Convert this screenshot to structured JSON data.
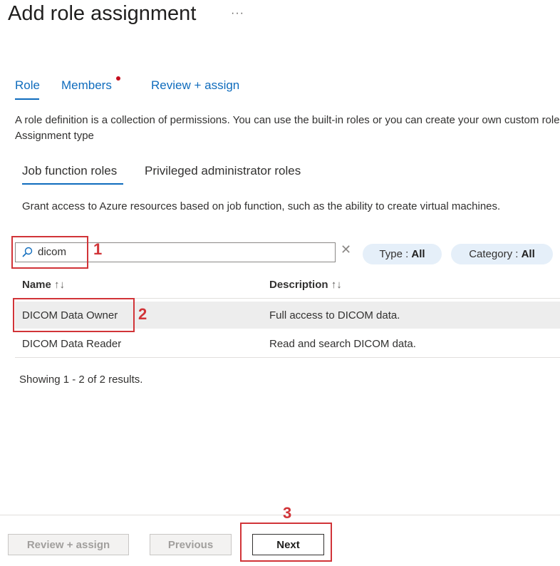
{
  "header": {
    "title": "Add role assignment",
    "more_label": "···"
  },
  "tabs": [
    {
      "label": "Role",
      "active": true
    },
    {
      "label": "Members",
      "has_indicator": true
    },
    {
      "label": "Review + assign"
    }
  ],
  "intro": {
    "description": "A role definition is a collection of permissions. You can use the built-in roles or you can create your own custom roles.",
    "assignment_type_label": "Assignment type"
  },
  "role_tabs": [
    {
      "label": "Job function roles",
      "active": true
    },
    {
      "label": "Privileged administrator roles"
    }
  ],
  "grant_text": "Grant access to Azure resources based on job function, such as the ability to create virtual machines.",
  "search": {
    "value": "dicom",
    "icon": "search-icon",
    "clear_icon": "close-icon"
  },
  "filters": [
    {
      "label": "Type : ",
      "value": "All"
    },
    {
      "label": "Category : ",
      "value": "All"
    }
  ],
  "table": {
    "columns": [
      {
        "label": "Name",
        "sort": "↑↓"
      },
      {
        "label": "Description",
        "sort": "↑↓"
      }
    ],
    "rows": [
      {
        "name": "DICOM Data Owner",
        "description": "Full access to DICOM data.",
        "selected": true
      },
      {
        "name": "DICOM Data Reader",
        "description": "Read and search DICOM data.",
        "selected": false
      }
    ]
  },
  "results_text": "Showing 1 - 2 of 2 results.",
  "footer": {
    "review_label": "Review + assign",
    "previous_label": "Previous",
    "next_label": "Next"
  },
  "annotations": {
    "step1": "1",
    "step2": "2",
    "step3": "3",
    "color": "#d13438"
  },
  "colors": {
    "accent": "#0f6cbd",
    "pill_bg": "#e5eff9",
    "selected_row": "#ededed"
  }
}
